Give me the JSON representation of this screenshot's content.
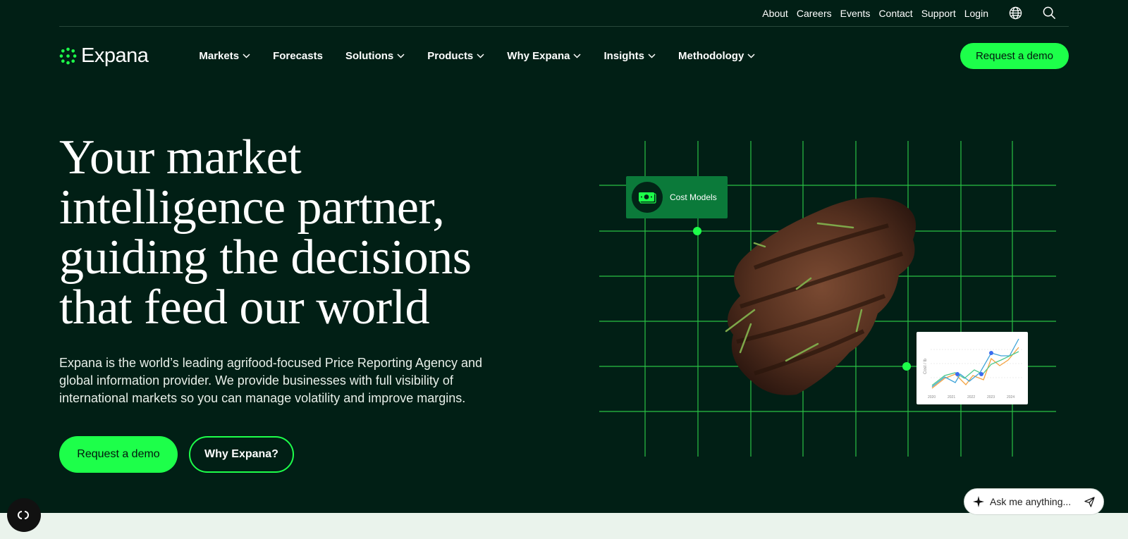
{
  "utility_nav": {
    "links": [
      "About",
      "Careers",
      "Events",
      "Contact",
      "Support",
      "Login"
    ],
    "icons": [
      "globe-icon",
      "search-icon"
    ]
  },
  "brand": {
    "name": "Expana",
    "accent": "#1dff4a",
    "background": "#011f15"
  },
  "main_nav": {
    "items": [
      {
        "label": "Markets",
        "has_dropdown": true
      },
      {
        "label": "Forecasts",
        "has_dropdown": false
      },
      {
        "label": "Solutions",
        "has_dropdown": true
      },
      {
        "label": "Products",
        "has_dropdown": true
      },
      {
        "label": "Why Expana",
        "has_dropdown": true
      },
      {
        "label": "Insights",
        "has_dropdown": true
      },
      {
        "label": "Methodology",
        "has_dropdown": true
      }
    ],
    "cta_label": "Request a demo"
  },
  "hero": {
    "title_lines": [
      "Your market",
      "intelligence partner,",
      "guiding the decisions",
      "that feed our world"
    ],
    "description": "Expana is the world’s leading agrifood-focused Price Reporting Agency and global information provider. We provide businesses with full visibility of international markets so you can manage volatility and improve margins.",
    "primary_button": "Request a demo",
    "secondary_button": "Why Expana?"
  },
  "visual": {
    "card_label": "Cost Models",
    "card_icon": "money-icon",
    "mini_chart": {
      "ylabel": "Cost / lb",
      "x_labels": [
        "2020",
        "2021",
        "2022",
        "2023",
        "2024"
      ]
    }
  },
  "assistant": {
    "placeholder": "Ask me anything..."
  }
}
